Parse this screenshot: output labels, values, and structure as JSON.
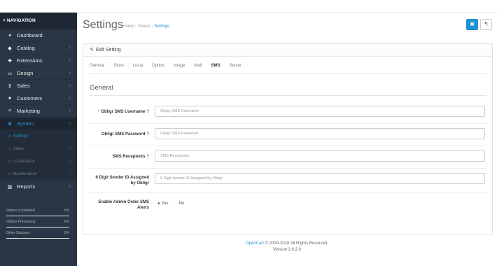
{
  "nav": {
    "heading": "NAVIGATION",
    "items": [
      {
        "label": "Dashboard",
        "icon": "dashboard-icon",
        "glyph": "◕"
      },
      {
        "label": "Catalog",
        "icon": "tag-icon",
        "glyph": "◆"
      },
      {
        "label": "Extensions",
        "icon": "puzzle-icon",
        "glyph": "✚"
      },
      {
        "label": "Design",
        "icon": "monitor-icon",
        "glyph": "▭"
      },
      {
        "label": "Sales",
        "icon": "cart-icon",
        "glyph": "⊻"
      },
      {
        "label": "Customers",
        "icon": "user-icon",
        "glyph": "●"
      },
      {
        "label": "Marketing",
        "icon": "share-icon",
        "glyph": "<"
      },
      {
        "label": "System",
        "icon": "cog-icon",
        "glyph": "✱"
      }
    ],
    "sub": [
      {
        "label": "Settings"
      },
      {
        "label": "Users"
      },
      {
        "label": "Localisation"
      },
      {
        "label": "Maintenance"
      }
    ],
    "reports": {
      "label": "Reports",
      "icon": "bar-chart-icon",
      "glyph": "▥"
    },
    "stats": [
      {
        "label": "Orders Completed",
        "pct": "0%",
        "value": 0
      },
      {
        "label": "Orders Processing",
        "pct": "0%",
        "value": 0
      },
      {
        "label": "Other Statuses",
        "pct": "0%",
        "value": 0
      }
    ]
  },
  "header": {
    "title": "Settings",
    "breadcrumb": [
      "Home",
      "Stores",
      "Settings"
    ]
  },
  "panel": {
    "heading": "Edit Setting",
    "tabs": [
      "General",
      "Store",
      "Local",
      "Option",
      "Image",
      "Mail",
      "SMS",
      "Server"
    ],
    "active_tab": "SMS",
    "legend": "General",
    "fields": {
      "username": {
        "label": "Obligr SMS Username",
        "placeholder": "Obligr SMS Username",
        "value": ""
      },
      "password": {
        "label": "Obligr SMS Password",
        "placeholder": "Obligr SMS Password",
        "value": ""
      },
      "recipients": {
        "label": "SMS Recepients",
        "placeholder": "SMS Recepients",
        "value": ""
      },
      "sender_line1": "6 Digit Sender ID Assigned",
      "sender_line2": "by Obligr",
      "sender_placeholder": "6 Digit Sender ID Assigned by Obligr",
      "alerts_line1": "Enable Admin Order SMS",
      "alerts_line2": "Alerts",
      "yes": "Yes",
      "no": "No",
      "alerts_selected": "Yes"
    }
  },
  "footer": {
    "brand": "OpenCart",
    "copy": "© 2009-2018 All Rights Reserved.",
    "version": "Version 3.0.2.0"
  },
  "colors": {
    "accent": "#1e91cf",
    "sidebar": "#2a3645",
    "required": "#f56b6b"
  }
}
